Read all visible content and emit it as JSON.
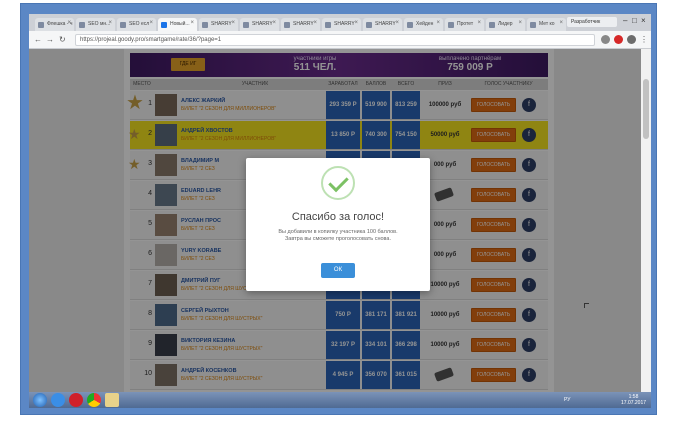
{
  "browser": {
    "tabs": [
      {
        "label": "Флешка - ч",
        "active": false
      },
      {
        "label": "SEO мн...",
        "active": false
      },
      {
        "label": "SEO есл",
        "active": false
      },
      {
        "label": "Новый...",
        "active": true
      },
      {
        "label": "SHARRY",
        "active": false
      },
      {
        "label": "SHARRY",
        "active": false
      },
      {
        "label": "SHARRY",
        "active": false
      },
      {
        "label": "SHARRY",
        "active": false
      },
      {
        "label": "SHARRY",
        "active": false
      },
      {
        "label": "Хейден",
        "active": false
      },
      {
        "label": "Протет",
        "active": false
      },
      {
        "label": "Лидер",
        "active": false
      },
      {
        "label": "Мет ко",
        "active": false
      }
    ],
    "profile": "Разработчик",
    "url": "https://projeal.goody.pro/smartgame/rate/36/?page=1"
  },
  "page": {
    "banner": {
      "button_label": "ГДЕ ИГ",
      "participants_label": "участники игры",
      "participants_value": "511 ЧЕЛ.",
      "payout_label": "выплачено партнёрам",
      "payout_value": "759 009 Р"
    },
    "headers": [
      "МЕСТО",
      "УЧАСТНИК",
      "ЗАРАБОТАЛ",
      "БАЛЛОВ",
      "ВСЕГО",
      "ПРИЗ",
      "ГОЛОС УЧАСТНИКУ"
    ],
    "vote_label": "ГОЛОСОВАТЬ",
    "rows": [
      {
        "place": "1",
        "name": "АЛЕКС ЖАРКИЙ",
        "ticket": "БИЛЕТ \"2 СЕЗОН ДЛЯ МИЛЛИОНЕРОВ\"",
        "earned": "293 359 Р",
        "points": "519 900",
        "total": "813 259",
        "prize": "100000 руб"
      },
      {
        "place": "2",
        "name": "АНДРЕЙ ХВОСТОВ",
        "ticket": "БИЛЕТ \"2 СЕЗОН ДЛЯ МИЛЛИОНЕРОВ\"",
        "earned": "13 850 Р",
        "points": "740 300",
        "total": "754 150",
        "prize": "50000 руб"
      },
      {
        "place": "3",
        "name": "ВЛАДИМИР М",
        "ticket": "БИЛЕТ \"2 СЕЗ",
        "earned": "",
        "points": "",
        "total": "",
        "prize": "000 руб"
      },
      {
        "place": "4",
        "name": "EDUARD LEHR",
        "ticket": "БИЛЕТ \"2 СЕЗ",
        "earned": "",
        "points": "",
        "total": "",
        "prize": ""
      },
      {
        "place": "5",
        "name": "РУСЛАН ПРОС",
        "ticket": "БИЛЕТ \"2 СЕЗ",
        "earned": "",
        "points": "",
        "total": "",
        "prize": "000 руб"
      },
      {
        "place": "6",
        "name": "YURY KORABE",
        "ticket": "БИЛЕТ \"2 СЕЗ",
        "earned": "",
        "points": "",
        "total": "",
        "prize": "000 руб"
      },
      {
        "place": "7",
        "name": "ДМИТРИЙ ПУГ",
        "ticket": "БИЛЕТ \"2 СЕЗОН ДЛЯ ШУСТРЫХ\"",
        "earned": "233 Р",
        "points": "384 401",
        "total": "384 634",
        "prize": "10000 руб"
      },
      {
        "place": "8",
        "name": "СЕРГЕЙ РЫХТОН",
        "ticket": "БИЛЕТ \"2 СЕЗОН ДЛЯ ШУСТРЫХ\"",
        "earned": "750 Р",
        "points": "381 171",
        "total": "381 921",
        "prize": "10000 руб"
      },
      {
        "place": "9",
        "name": "ВИКТОРИЯ КЕЗИНА",
        "ticket": "БИЛЕТ \"2 СЕЗОН ДЛЯ ШУСТРЫХ\"",
        "earned": "32 197 Р",
        "points": "334 101",
        "total": "366 298",
        "prize": "10000 руб"
      },
      {
        "place": "10",
        "name": "АНДРЕЙ КОСЕНКОВ",
        "ticket": "БИЛЕТ \"2 СЕЗОН ДЛЯ ШУСТРЫХ\"",
        "earned": "4 945 Р",
        "points": "356 070",
        "total": "361 015",
        "prize": ""
      }
    ]
  },
  "modal": {
    "title": "Спасибо за голос!",
    "text_line1": "Вы добавили в копилку участника 100 баллов.",
    "text_line2": "Завтра вы сможете проголосовать снова.",
    "ok_label": "ОК"
  },
  "taskbar": {
    "tray": "РУ",
    "time": "1:58",
    "date": "17.07.2017"
  },
  "colors": {
    "banner": "#6b2c8e",
    "number_cell": "#2b65b8",
    "vote_button": "#e06b14",
    "highlight_row": "#f7e51f",
    "ok_button": "#3b8fd9",
    "check": "#7cc164"
  }
}
